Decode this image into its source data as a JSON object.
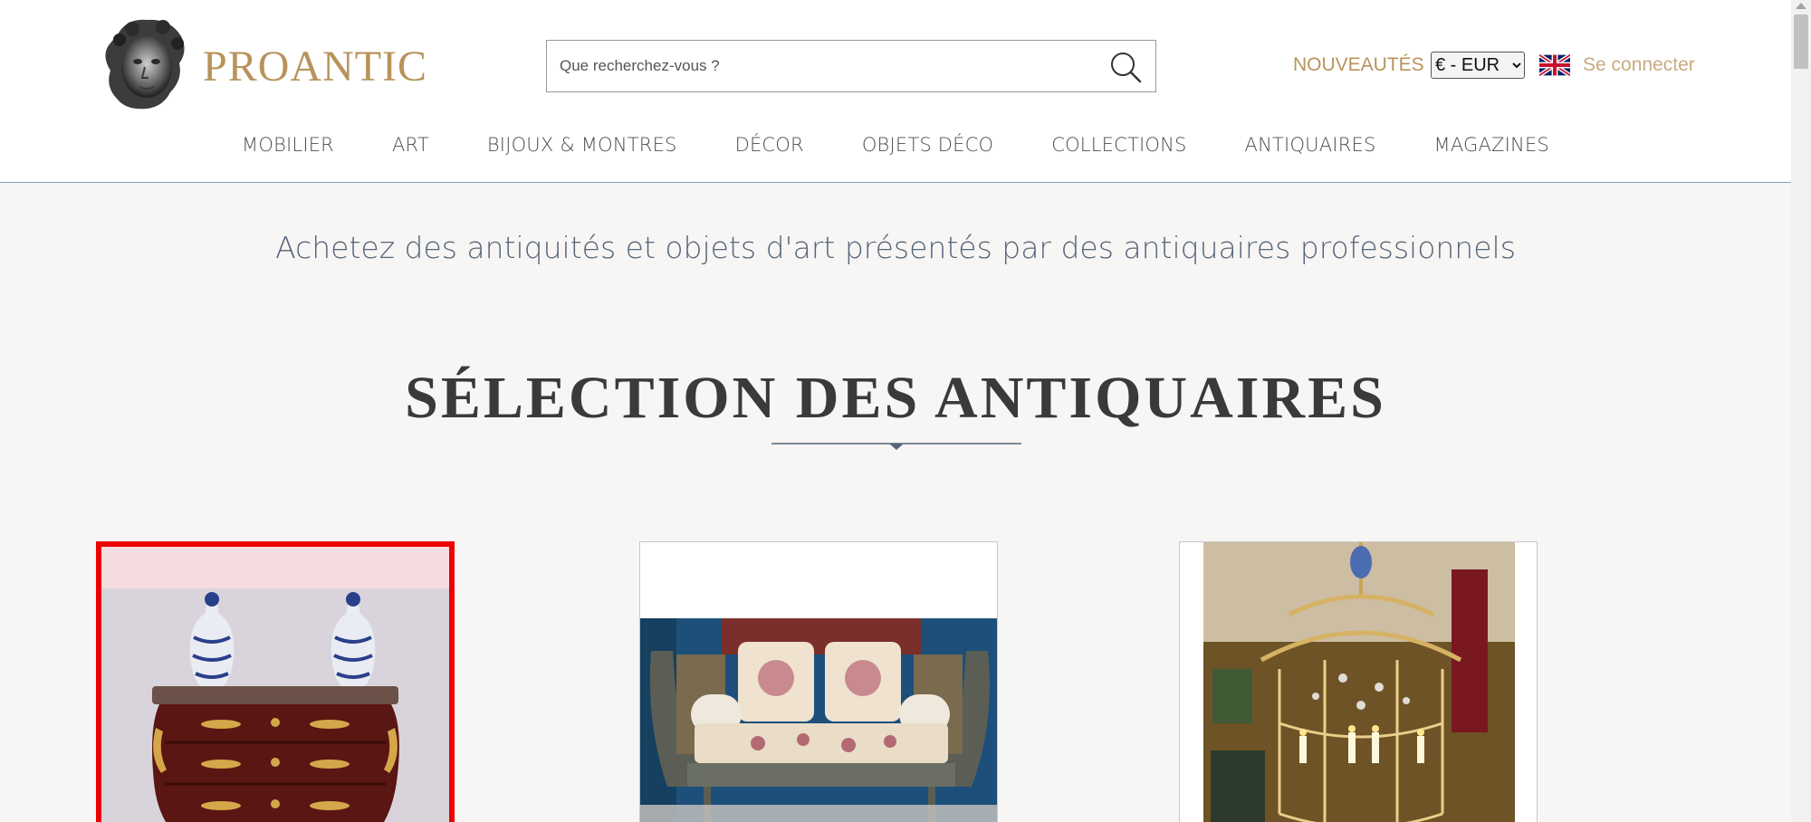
{
  "header": {
    "brand": "PROANTIC",
    "search_placeholder": "Que recherchez-vous ?",
    "new_label": "NOUVEAUTÉS",
    "currency_selected": "€ - EUR",
    "login_label": "Se connecter"
  },
  "nav": {
    "items": [
      {
        "label": "MOBILIER"
      },
      {
        "label": "ART"
      },
      {
        "label": "BIJOUX & MONTRES"
      },
      {
        "label": "DÉCOR"
      },
      {
        "label": "OBJETS DÉCO"
      },
      {
        "label": "COLLECTIONS"
      },
      {
        "label": "ANTIQUAIRES"
      },
      {
        "label": "MAGAZINES"
      }
    ]
  },
  "main": {
    "tagline": "Achetez des antiquités et objets d'art présentés par des antiquaires professionnels",
    "section_title": "SÉLECTION DES ANTIQUAIRES"
  },
  "colors": {
    "brand_gold": "#b8935a",
    "nav_text": "#4e4e4e",
    "highlight_border": "#ee0000"
  },
  "icons": [
    "search-icon",
    "uk-flag-icon",
    "logo-bust-icon"
  ]
}
